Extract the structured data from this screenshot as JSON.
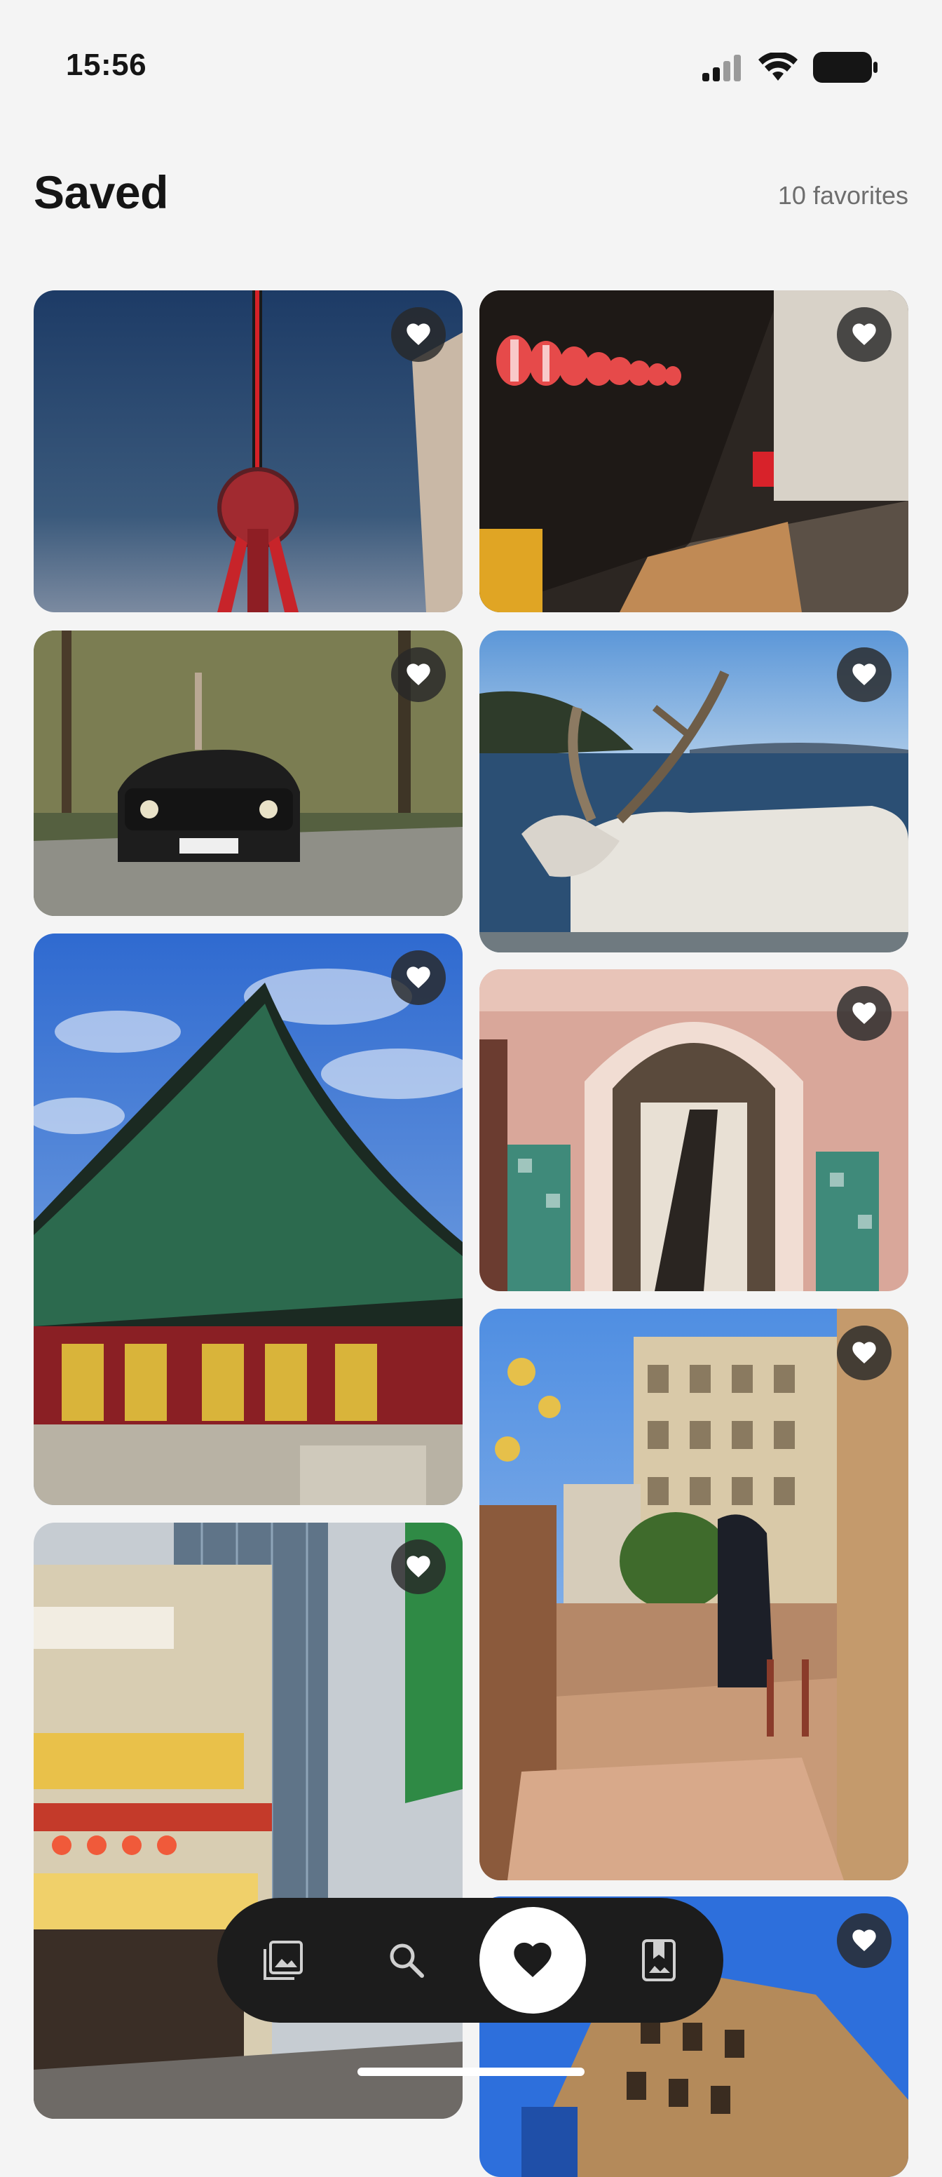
{
  "status_bar": {
    "time": "15:56"
  },
  "header": {
    "title": "Saved",
    "count": "10 favorites"
  },
  "photos": [
    {
      "subject": "Red TV tower at dusk",
      "favorited": true
    },
    {
      "subject": "Alley with red lanterns",
      "favorited": true
    },
    {
      "subject": "Black convertible on forest road",
      "favorited": true
    },
    {
      "subject": "Reindeer by a lake",
      "favorited": true
    },
    {
      "subject": "Korean temple roof",
      "favorited": true
    },
    {
      "subject": "Moroccan arched doorway",
      "favorited": true
    },
    {
      "subject": "Sunny Paris cafe terrace",
      "favorited": true
    },
    {
      "subject": "Japanese izakaya street",
      "favorited": true
    },
    {
      "subject": "Building facade under blue sky",
      "favorited": true
    }
  ],
  "nav": {
    "items": [
      {
        "icon": "gallery-icon",
        "active": false
      },
      {
        "icon": "search-icon",
        "active": false
      },
      {
        "icon": "heart-icon",
        "active": true
      },
      {
        "icon": "bookmark-icon",
        "active": false
      }
    ]
  },
  "colors": {
    "background": "#f4f4f4",
    "nav": "#1c1c1c",
    "accent": "#ffffff"
  }
}
